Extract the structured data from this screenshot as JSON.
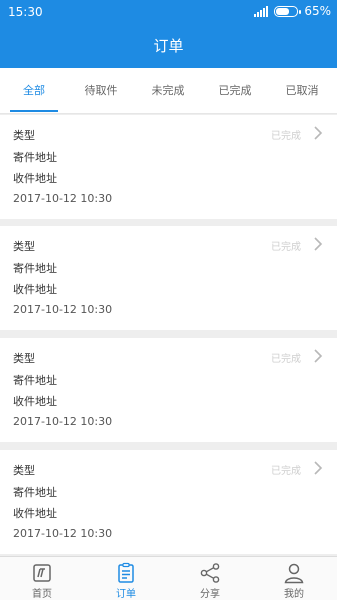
{
  "status_bar": {
    "time": "15:30",
    "battery_percent": "65%",
    "battery_level": 0.65
  },
  "header": {
    "title": "订单"
  },
  "tabs": [
    {
      "label": "全部",
      "active": true
    },
    {
      "label": "待取件",
      "active": false
    },
    {
      "label": "未完成",
      "active": false
    },
    {
      "label": "已完成",
      "active": false
    },
    {
      "label": "已取消",
      "active": false
    }
  ],
  "orders": [
    {
      "type_label": "类型",
      "sender_label": "寄件地址",
      "receiver_label": "收件地址",
      "datetime": "2017-10-12 10:30",
      "status": "已完成"
    },
    {
      "type_label": "类型",
      "sender_label": "寄件地址",
      "receiver_label": "收件地址",
      "datetime": "2017-10-12 10:30",
      "status": "已完成"
    },
    {
      "type_label": "类型",
      "sender_label": "寄件地址",
      "receiver_label": "收件地址",
      "datetime": "2017-10-12 10:30",
      "status": "已完成"
    },
    {
      "type_label": "类型",
      "sender_label": "寄件地址",
      "receiver_label": "收件地址",
      "datetime": "2017-10-12 10:30",
      "status": "已完成"
    }
  ],
  "bottom_nav": [
    {
      "label": "首页",
      "icon": "home-icon",
      "active": false
    },
    {
      "label": "订单",
      "icon": "order-icon",
      "active": true
    },
    {
      "label": "分享",
      "icon": "share-icon",
      "active": false
    },
    {
      "label": "我的",
      "icon": "profile-icon",
      "active": false
    }
  ],
  "colors": {
    "primary": "#1e8be3",
    "status_text": "#cfcfcf"
  }
}
